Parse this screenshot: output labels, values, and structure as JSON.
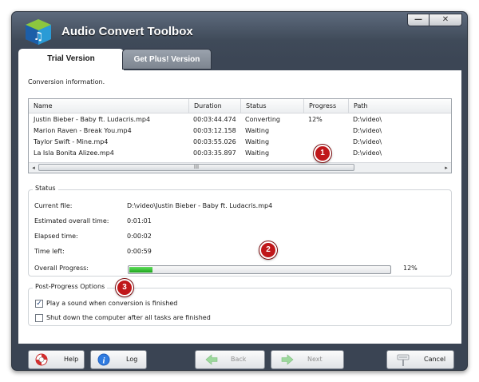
{
  "window": {
    "title": "Audio Convert Toolbox",
    "min_glyph": "—",
    "close_glyph": "✕"
  },
  "tabs": [
    {
      "label": "Trial Version",
      "active": true
    },
    {
      "label": "Get Plus! Version",
      "active": false
    }
  ],
  "conversion": {
    "label": "Conversion information.",
    "columns": [
      "Name",
      "Duration",
      "Status",
      "Progress",
      "Path"
    ],
    "rows": [
      {
        "name": "Justin Bieber - Baby ft. Ludacris.mp4",
        "duration": "00:03:44.474",
        "status": "Converting",
        "progress": "12%",
        "path": "D:\\video\\"
      },
      {
        "name": "Marion Raven - Break You.mp4",
        "duration": "00:03:12.158",
        "status": "Waiting",
        "progress": "",
        "path": "D:\\video\\"
      },
      {
        "name": "Taylor Swift - Mine.mp4",
        "duration": "00:03:55.026",
        "status": "Waiting",
        "progress": "",
        "path": "D:\\video\\"
      },
      {
        "name": "La Isla Bonita Alizee.mp4",
        "duration": "00:03:35.897",
        "status": "Waiting",
        "progress": "",
        "path": "D:\\video\\"
      }
    ],
    "scroll_grip": "III",
    "scroll_left": "◂",
    "scroll_right": "▸"
  },
  "status": {
    "title": "Status",
    "current_file_label": "Current file:",
    "current_file": "D:\\video\\Justin Bieber - Baby ft. Ludacris.mp4",
    "estimated_label": "Estimated overall time:",
    "estimated": "0:01:01",
    "elapsed_label": "Elapsed time:",
    "elapsed": "0:00:02",
    "left_label": "Time left:",
    "left": "0:00:59",
    "overall_label": "Overall Progress:",
    "overall_percent": 0.09,
    "overall_text": "12%"
  },
  "post_options": {
    "title": "Post-Progress Options",
    "play_sound_label": "Play a sound when conversion is finished",
    "play_sound_checked": true,
    "shutdown_label": "Shut down the computer after all tasks are finished",
    "shutdown_checked": false
  },
  "callouts": [
    "1",
    "2",
    "3"
  ],
  "buttons": {
    "help": "Help",
    "log": "Log",
    "back": "Back",
    "next": "Next",
    "cancel": "Cancel"
  },
  "icons": {
    "app": "app-cube-icon",
    "help": "lifebuoy-icon",
    "log": "info-icon",
    "back": "arrow-left-icon",
    "next": "arrow-right-icon",
    "cancel": "cancel-sign-icon"
  },
  "colors": {
    "title_bar": "#3f4a59",
    "progress_fill": "#1ca51c",
    "callout": "#c0171a",
    "disabled_arrow": "#9cd79c"
  }
}
